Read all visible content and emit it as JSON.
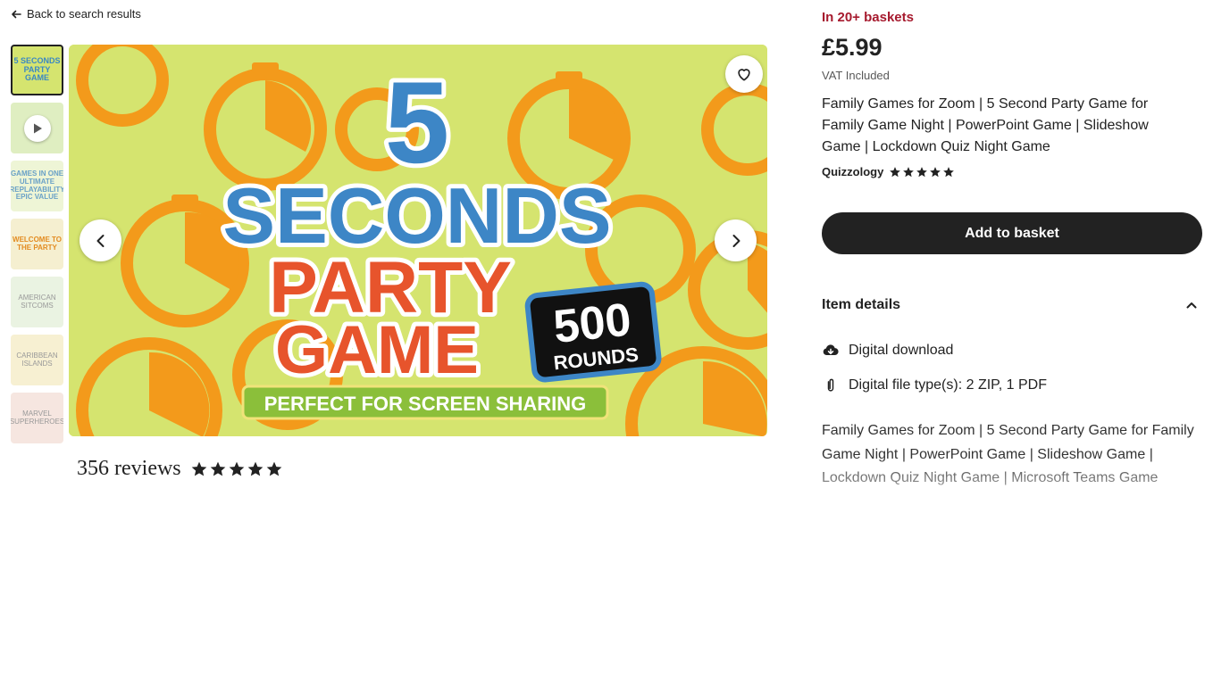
{
  "nav": {
    "back_label": "Back to search results",
    "back_icon": "arrow-left-icon"
  },
  "gallery": {
    "thumbnails": [
      {
        "label": "5 SECONDS PARTY GAME",
        "type": "image",
        "active": true
      },
      {
        "label": "",
        "type": "video",
        "active": false
      },
      {
        "label": "GAMES IN ONE ULTIMATE REPLAYABILITY EPIC VALUE",
        "type": "image",
        "active": false
      },
      {
        "label": "WELCOME TO THE PARTY",
        "type": "image",
        "active": false
      },
      {
        "label": "AMERICAN SITCOMS",
        "type": "image",
        "active": false
      },
      {
        "label": "CARIBBEAN ISLANDS",
        "type": "image",
        "active": false
      },
      {
        "label": "MARVEL SUPERHEROES",
        "type": "image",
        "active": false
      }
    ],
    "hero": {
      "line1": "5",
      "line2": "SECONDS",
      "line3": "PARTY",
      "line4": "GAME",
      "badge_number": "500",
      "badge_text": "ROUNDS",
      "banner": "PERFECT FOR SCREEN SHARING",
      "bg_color": "#d5e46f",
      "accent_orange": "#f39a1b"
    }
  },
  "reviews": {
    "count_label": "356 reviews",
    "rating": 5
  },
  "product": {
    "baskets": "In 20+ baskets",
    "price": "£5.99",
    "vat": "VAT Included",
    "title": "Family Games for Zoom | 5 Second Party Game for Family Game Night | PowerPoint Game | Slideshow Game | Lockdown Quiz Night Game",
    "shop_name": "Quizzology",
    "shop_rating": 5,
    "add_to_basket": "Add to basket",
    "item_details": "Item details",
    "details": [
      {
        "icon": "cloud-download-icon",
        "text": "Digital download"
      },
      {
        "icon": "paperclip-icon",
        "text": "Digital file type(s): 2 ZIP, 1 PDF"
      }
    ],
    "description": "Family Games for Zoom | 5 Second Party Game for Family Game Night | PowerPoint Game | Slideshow Game | Lockdown Quiz Night Game | Microsoft Teams Game"
  },
  "colors": {
    "basket_red": "#a61a2e",
    "button_dark": "#222222"
  }
}
